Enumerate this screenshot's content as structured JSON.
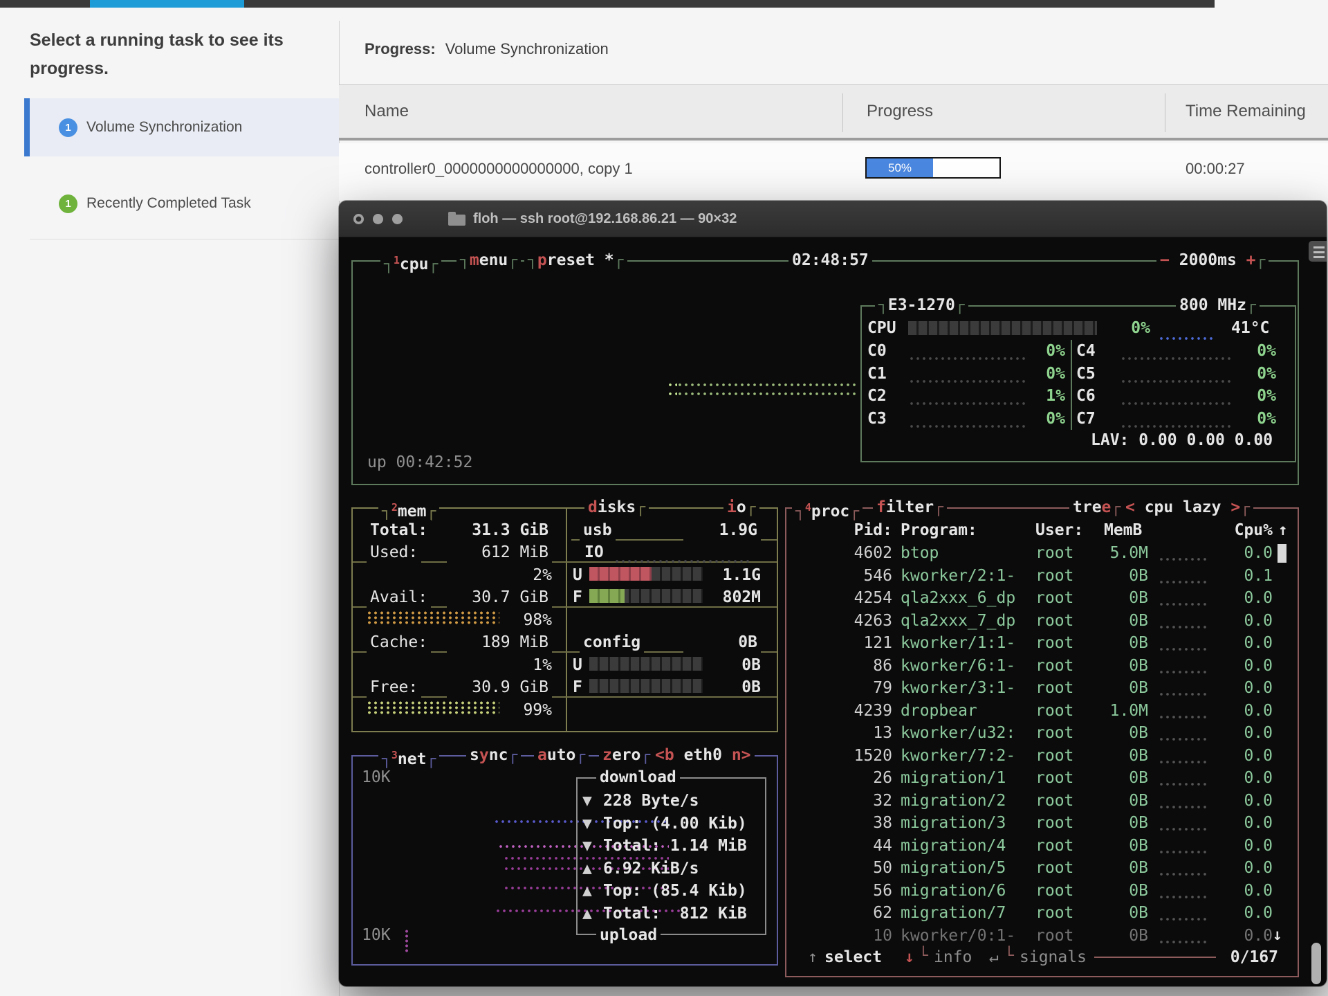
{
  "colors": {
    "tab_accent": "#1e9cd7",
    "selected_accent": "#3b79cf",
    "badge_blue": "#4a90e2",
    "badge_green": "#6fb33c",
    "progress_fill": "#4a87e0",
    "btop_red": "#c65353",
    "btop_green_text": "#8cc99c"
  },
  "task_panel": {
    "heading": "Select a running task to see its progress.",
    "items": [
      {
        "badge": "1",
        "label": "Volume Synchronization"
      },
      {
        "badge": "1",
        "label": "Recently Completed Task"
      }
    ]
  },
  "progress_panel": {
    "label": "Progress:",
    "value": "Volume Synchronization",
    "columns": [
      "Name",
      "Progress",
      "Time Remaining"
    ],
    "row": {
      "name": "controller0_0000000000000000, copy 1",
      "progress_pct": 50,
      "progress_label": "50%",
      "time_remaining": "00:00:27"
    }
  },
  "terminal": {
    "title": "floh — ssh root@192.168.86.21 — 90×32",
    "btop": {
      "header": {
        "box_num": "1",
        "box_title": "cpu",
        "menu_hot": "m",
        "menu_rest": "enu",
        "preset_hot": "p",
        "preset_rest": "reset *",
        "clock": "02:48:57",
        "minus": "−",
        "interval": "2000ms",
        "plus": "+"
      },
      "cpu": {
        "model": "E3-1270",
        "freq": "800 MHz",
        "total_label": "CPU",
        "total_pct": "0%",
        "temp": "41°C",
        "cores_left": [
          {
            "label": "C0",
            "pct": "0%"
          },
          {
            "label": "C1",
            "pct": "0%"
          },
          {
            "label": "C2",
            "pct": "1%"
          },
          {
            "label": "C3",
            "pct": "0%"
          }
        ],
        "cores_right": [
          {
            "label": "C4",
            "pct": "0%"
          },
          {
            "label": "C5",
            "pct": "0%"
          },
          {
            "label": "C6",
            "pct": "0%"
          },
          {
            "label": "C7",
            "pct": "0%"
          }
        ],
        "lav": "LAV: 0.00 0.00 0.00",
        "uptime": "up 00:42:52"
      },
      "mem": {
        "box_num": "2",
        "box_title": "mem",
        "total_label": "Total:",
        "total": "31.3 GiB",
        "used_label": "Used:",
        "used": "612 MiB",
        "used_pct": "2%",
        "avail_label": "Avail:",
        "avail": "30.7 GiB",
        "avail_meter_pct": "98%",
        "cache_label": "Cache:",
        "cache": "189 MiB",
        "cache_pct": "1%",
        "free_label": "Free:",
        "free": "30.9 GiB",
        "free_meter_pct": "99%"
      },
      "disks": {
        "title_hot": "d",
        "title_rest": "isks",
        "io_hot": "i",
        "io_rest": "o",
        "usb": {
          "name": "usb",
          "size": "1.9G",
          "io_label": "IO",
          "used_label": "U",
          "used": "1.1G",
          "used_fill_pct": 55,
          "free_label": "F",
          "free": "802M",
          "free_fill_pct": 31
        },
        "config": {
          "name": "config",
          "size": "0B",
          "used_label": "U",
          "used": "0B",
          "used_fill_pct": 0,
          "free_label": "F",
          "free": "0B",
          "free_fill_pct": 0
        }
      },
      "net": {
        "box_num": "3",
        "box_title": "net",
        "sync_pre": "s",
        "sync_hot": "y",
        "sync_rest": "nc",
        "auto_hot": "a",
        "auto_rest": "uto",
        "zero_hot": "z",
        "zero_rest": "ero",
        "iface_prev": "<b",
        "iface": "eth0",
        "iface_next": "n>",
        "scale_top": "10K",
        "scale_bottom": "10K",
        "download_title": "download",
        "upload_title": "upload",
        "stats": [
          {
            "arrow": "▼",
            "text": "228 Byte/s"
          },
          {
            "arrow": "▼",
            "text": "Top: (4.00 Kib)"
          },
          {
            "arrow": "▼",
            "text": "Total: 1.14 MiB"
          },
          {
            "arrow": "▲",
            "text": "6.92 KiB/s"
          },
          {
            "arrow": "▲",
            "text": "Top: (85.4 Kib)"
          },
          {
            "arrow": "▲",
            "text": "Total:  812 KiB"
          }
        ]
      },
      "proc": {
        "box_num": "4",
        "box_title": "proc",
        "filter_hot": "f",
        "filter_rest": "ilter",
        "tree_pre": "tre",
        "tree_hot": "e",
        "sort_prev": "<",
        "sort_label": " cpu lazy ",
        "sort_next": ">",
        "headers": {
          "pid": "Pid:",
          "program": "Program:",
          "user": "User:",
          "mem": "MemB",
          "cpu": "Cpu%",
          "sort_arrow": "↑"
        },
        "rows": [
          {
            "pid": "4602",
            "program": "btop",
            "user": "root",
            "mem": "5.0M",
            "cpu": "0.0",
            "cls": ""
          },
          {
            "pid": "546",
            "program": "kworker/2:1-",
            "user": "root",
            "mem": "0B",
            "cpu": "0.1",
            "cls": ""
          },
          {
            "pid": "4254",
            "program": "qla2xxx_6_dp",
            "user": "root",
            "mem": "0B",
            "cpu": "0.0",
            "cls": ""
          },
          {
            "pid": "4263",
            "program": "qla2xxx_7_dp",
            "user": "root",
            "mem": "0B",
            "cpu": "0.0",
            "cls": ""
          },
          {
            "pid": "121",
            "program": "kworker/1:1-",
            "user": "root",
            "mem": "0B",
            "cpu": "0.0",
            "cls": ""
          },
          {
            "pid": "86",
            "program": "kworker/6:1-",
            "user": "root",
            "mem": "0B",
            "cpu": "0.0",
            "cls": ""
          },
          {
            "pid": "79",
            "program": "kworker/3:1-",
            "user": "root",
            "mem": "0B",
            "cpu": "0.0",
            "cls": ""
          },
          {
            "pid": "4239",
            "program": "dropbear",
            "user": "root",
            "mem": "1.0M",
            "cpu": "0.0",
            "cls": ""
          },
          {
            "pid": "13",
            "program": "kworker/u32:",
            "user": "root",
            "mem": "0B",
            "cpu": "0.0",
            "cls": ""
          },
          {
            "pid": "1520",
            "program": "kworker/7:2-",
            "user": "root",
            "mem": "0B",
            "cpu": "0.0",
            "cls": ""
          },
          {
            "pid": "26",
            "program": "migration/1",
            "user": "root",
            "mem": "0B",
            "cpu": "0.0",
            "cls": ""
          },
          {
            "pid": "32",
            "program": "migration/2",
            "user": "root",
            "mem": "0B",
            "cpu": "0.0",
            "cls": ""
          },
          {
            "pid": "38",
            "program": "migration/3",
            "user": "root",
            "mem": "0B",
            "cpu": "0.0",
            "cls": ""
          },
          {
            "pid": "44",
            "program": "migration/4",
            "user": "root",
            "mem": "0B",
            "cpu": "0.0",
            "cls": ""
          },
          {
            "pid": "50",
            "program": "migration/5",
            "user": "root",
            "mem": "0B",
            "cpu": "0.0",
            "cls": ""
          },
          {
            "pid": "56",
            "program": "migration/6",
            "user": "root",
            "mem": "0B",
            "cpu": "0.0",
            "cls": ""
          },
          {
            "pid": "62",
            "program": "migration/7",
            "user": "root",
            "mem": "0B",
            "cpu": "0.0",
            "cls": ""
          },
          {
            "pid": "10",
            "program": "kworker/0:1-",
            "user": "root",
            "mem": "0B",
            "cpu": "0.0",
            "cls": "dim"
          }
        ],
        "footer": {
          "up_arrow": "↑",
          "select": "select",
          "down_arrow": "↓",
          "info": "info",
          "enter": "↵",
          "signals": "signals",
          "count": "0/167",
          "scroll_down": "↓"
        }
      }
    }
  }
}
